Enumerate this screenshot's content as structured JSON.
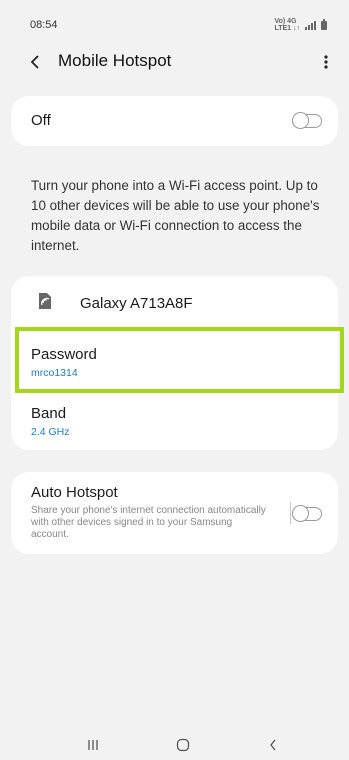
{
  "status_bar": {
    "time": "08:54",
    "network_label": "VoLTE 4G",
    "icons": [
      "volte-icon",
      "signal-icon",
      "battery-icon"
    ]
  },
  "header": {
    "title": "Mobile Hotspot",
    "back_icon": "back-arrow-icon",
    "more_icon": "more-options-icon"
  },
  "hotspot_toggle": {
    "label": "Off",
    "state": "off"
  },
  "description": "Turn your phone into a Wi-Fi access point. Up to 10 other devices will be able to use your phone's mobile data or Wi-Fi connection to access the internet.",
  "network": {
    "icon": "hotspot-device-icon",
    "name": "Galaxy A713A8F",
    "password_label": "Password",
    "password_value": "mrco1314",
    "band_label": "Band",
    "band_value": "2.4 GHz"
  },
  "auto_hotspot": {
    "title": "Auto Hotspot",
    "description": "Share your phone's internet connection automatically with other devices signed in to your Samsung account.",
    "state": "off"
  },
  "nav_bar": {
    "items": [
      "recent-apps-icon",
      "home-icon",
      "back-icon"
    ]
  },
  "colors": {
    "background": "#f2f2f2",
    "card": "#ffffff",
    "accent_value": "#1c7dc9",
    "highlight": "#a6d61c"
  }
}
